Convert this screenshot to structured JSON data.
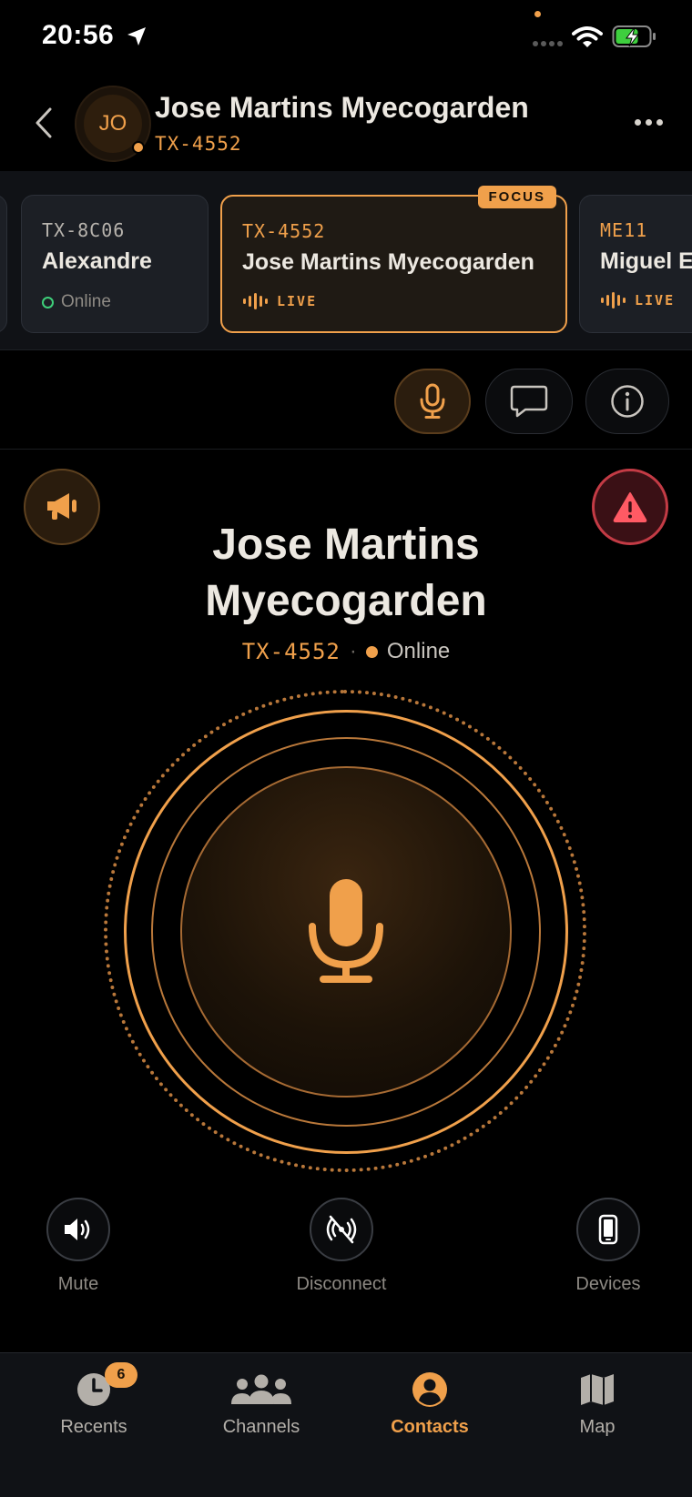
{
  "status_bar": {
    "time": "20:56"
  },
  "header": {
    "avatar_initials": "JO",
    "name": "Jose Martins Myecogarden",
    "id": "TX-4552"
  },
  "channels": [
    {
      "id": "TX-8C06",
      "name": "Alexandre",
      "status": "Online"
    },
    {
      "id": "TX-4552",
      "name": "Jose Martins Myecogarden",
      "status": "LIVE",
      "badge": "FOCUS"
    },
    {
      "id": "ME11",
      "name": "Miguel E",
      "status": "LIVE"
    }
  ],
  "contact": {
    "name_line1": "Jose Martins",
    "name_line2": "Myecogarden",
    "id": "TX-4552",
    "separator": "·",
    "status": "Online"
  },
  "controls": {
    "mute": "Mute",
    "disconnect": "Disconnect",
    "devices": "Devices"
  },
  "tabs": [
    {
      "label": "Recents",
      "badge": "6"
    },
    {
      "label": "Channels"
    },
    {
      "label": "Contacts"
    },
    {
      "label": "Map"
    }
  ],
  "colors": {
    "accent": "#f0a04b",
    "alert": "#c33b45",
    "online": "#3ecf7a",
    "background": "#000000"
  },
  "icons": {
    "action_row": [
      "mic-icon",
      "chat-icon",
      "info-icon"
    ],
    "broadcast": "megaphone-icon",
    "alert": "warning-icon"
  }
}
